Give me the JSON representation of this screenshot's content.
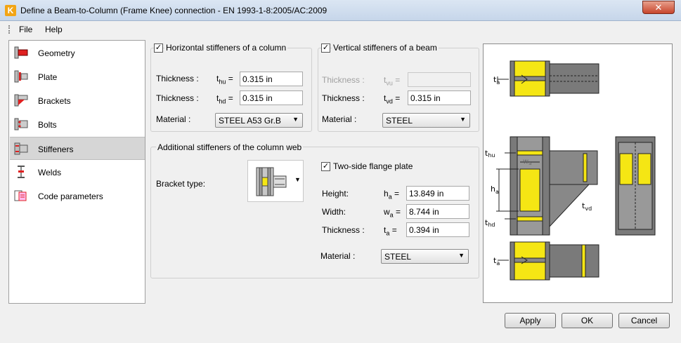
{
  "window": {
    "title": "Define a Beam-to-Column (Frame Knee) connection - EN 1993-1-8:2005/AC:2009",
    "close_label": "✕",
    "app_icon_letter": "K"
  },
  "menu": {
    "file": "File",
    "help": "Help"
  },
  "sidebar": {
    "items": [
      {
        "label": "Geometry"
      },
      {
        "label": "Plate"
      },
      {
        "label": "Brackets"
      },
      {
        "label": "Bolts"
      },
      {
        "label": "Stiffeners"
      },
      {
        "label": "Welds"
      },
      {
        "label": "Code parameters"
      }
    ],
    "active_index": 4
  },
  "horizontal_stiffeners": {
    "title": "Horizontal stiffeners of a column",
    "checked": true,
    "thickness_label": "Thickness :",
    "thu_symbol": "t",
    "thu_sub": "hu",
    "thu_value": "0.315 in",
    "thd_symbol": "t",
    "thd_sub": "hd",
    "thd_value": "0.315 in",
    "material_label": "Material :",
    "material_value": "STEEL A53 Gr.B"
  },
  "vertical_stiffeners": {
    "title": "Vertical stiffeners of a beam",
    "checked": true,
    "thickness_label": "Thickness :",
    "tvu_symbol": "t",
    "tvu_sub": "vu",
    "tvu_value": "",
    "tvd_symbol": "t",
    "tvd_sub": "vd",
    "tvd_value": "0.315 in",
    "material_label": "Material :",
    "material_value": "STEEL"
  },
  "additional_stiffeners": {
    "title": "Additional stiffeners of the column web",
    "bracket_type_label": "Bracket type:",
    "two_side_label": "Two-side flange plate",
    "two_side_checked": true,
    "height_label": "Height:",
    "ha_symbol": "h",
    "ha_sub": "a",
    "ha_value": "13.849 in",
    "width_label": "Width:",
    "wa_symbol": "w",
    "wa_sub": "a",
    "wa_value": "8.744 in",
    "thickness_label": "Thickness :",
    "ta_symbol": "t",
    "ta_sub": "a",
    "ta_value": "0.394 in",
    "material_label": "Material :",
    "material_value": "STEEL"
  },
  "preview_labels": {
    "ta": "t",
    "ta_sub": "a",
    "thu": "t",
    "thu_sub": "hu",
    "thd": "t",
    "thd_sub": "hd",
    "ha": "h",
    "ha_sub": "a",
    "wa": "w",
    "wa_sub": "a",
    "tvd": "t",
    "tvd_sub": "vd"
  },
  "buttons": {
    "apply": "Apply",
    "ok": "OK",
    "cancel": "Cancel"
  },
  "colors": {
    "accent": "#f2a516",
    "stiffener": "#f5e614",
    "steel": "#7a7a7a",
    "highlight": "#d6d6d6"
  }
}
